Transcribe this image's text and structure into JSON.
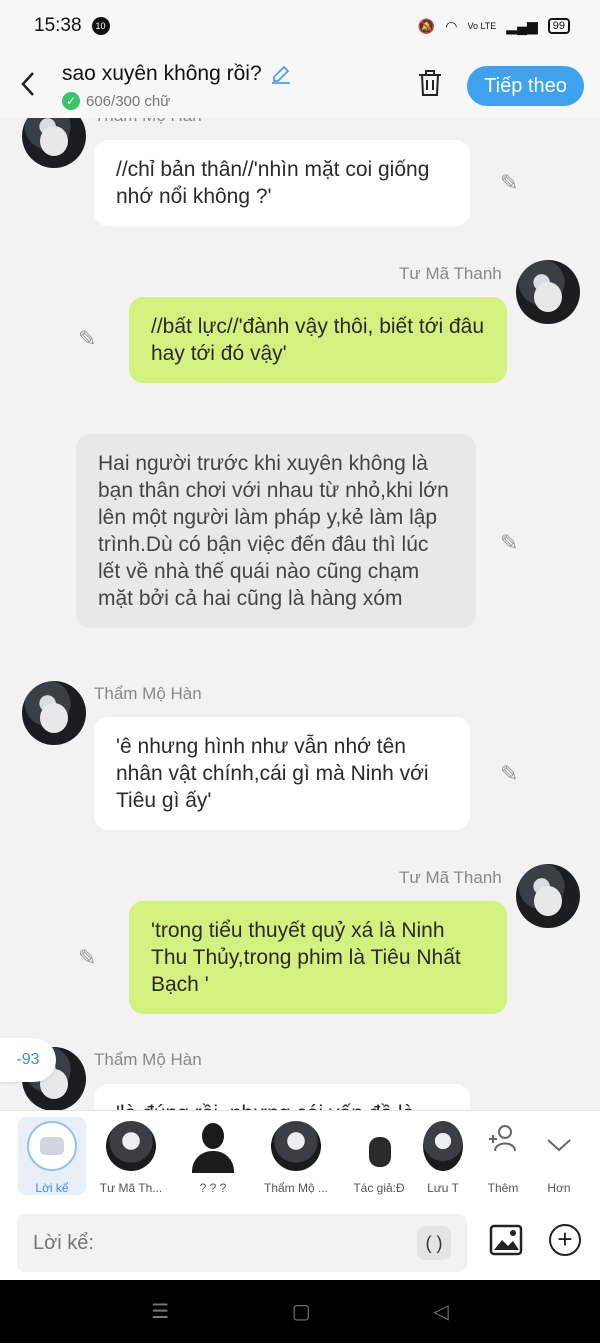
{
  "status": {
    "time": "15:38",
    "app_badge": "10",
    "battery": "99",
    "net": "Vo LTE"
  },
  "header": {
    "back": "<",
    "title": "sao xuyên không rồi?",
    "word_count": "606/300 chữ",
    "next_label": "Tiếp theo"
  },
  "messages": [
    {
      "speaker": "Thẩm Mộ Hàn",
      "text": "//chỉ bản thân//'nhìn mặt coi giống nhớ nổi không ?'"
    },
    {
      "speaker": "Tư Mã Thanh",
      "text": "//bất lực//'đành vậy thôi, biết tới đâu hay tới đó vậy'"
    },
    {
      "speaker": "",
      "text": "Hai người trước khi xuyên không là bạn thân chơi với nhau từ nhỏ,khi lớn lên một người làm pháp y,kẻ làm lập trình.Dù có bận việc đến đâu thì lúc lết về nhà thế quái nào cũng chạm mặt bởi cả hai cũng là hàng xóm"
    },
    {
      "speaker": "Thẩm Mộ Hàn",
      "text": "'ê nhưng hình như vẫn nhớ tên nhân vật chính,cái gì mà Ninh với Tiêu gì ấy'"
    },
    {
      "speaker": "Tư Mã Thanh",
      "text": "'trong tiểu thuyết quỷ xá là Ninh Thu Thủy,trong phim là Tiêu Nhất Bạch '"
    },
    {
      "speaker": "Thẩm Mộ Hàn",
      "text": "'là đúng rồi, nhưng cái vấn đề là"
    }
  ],
  "score_badge": "-93",
  "characters": [
    {
      "label": "Lời kể"
    },
    {
      "label": "Tư Mã Th..."
    },
    {
      "label": "? ? ?"
    },
    {
      "label": "Thẩm Mộ ..."
    },
    {
      "label": "Tác giả:Đ"
    },
    {
      "label": "Lưu T"
    },
    {
      "label": "Thêm"
    },
    {
      "label": "Hơn"
    }
  ],
  "input": {
    "placeholder": "Lời kể:",
    "paren_label": "( )"
  },
  "colors": {
    "accent": "#3fa2ef",
    "bubble_green": "#d4f17f",
    "bubble_white": "#ffffff",
    "narration_bg": "#e8e8e8"
  }
}
